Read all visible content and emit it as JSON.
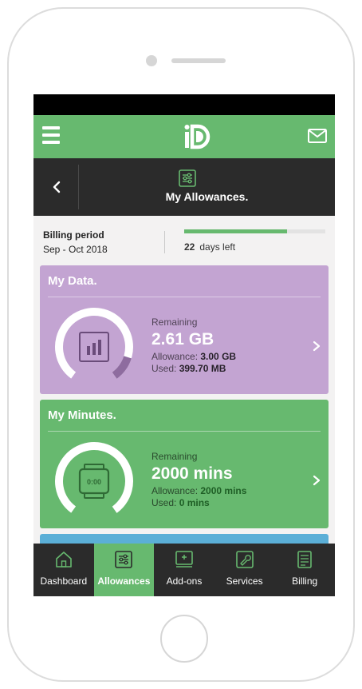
{
  "header": {
    "title": "My Allowances."
  },
  "billing": {
    "label": "Billing period",
    "dates": "Sep - Oct 2018",
    "days_left_value": "22",
    "days_left_text": "days left",
    "progress_fraction": 0.73
  },
  "cards": {
    "data": {
      "title": "My Data.",
      "remaining_label": "Remaining",
      "remaining_value": "2.61 GB",
      "allowance_label": "Allowance:",
      "allowance_value": "3.00 GB",
      "used_label": "Used:",
      "used_value": "399.70 MB",
      "used_fraction": 0.13,
      "color": "#c3a4d2"
    },
    "minutes": {
      "title": "My Minutes.",
      "remaining_label": "Remaining",
      "remaining_value": "2000 mins",
      "allowance_label": "Allowance:",
      "allowance_value": "2000 mins",
      "used_label": "Used:",
      "used_value": "0 mins",
      "timer_text": "0:00",
      "used_fraction": 0,
      "color": "#67b96f"
    }
  },
  "tabs": [
    {
      "label": "Dashboard",
      "icon": "home-icon"
    },
    {
      "label": "Allowances",
      "icon": "sliders-icon",
      "active": true
    },
    {
      "label": "Add-ons",
      "icon": "addon-icon"
    },
    {
      "label": "Services",
      "icon": "wrench-icon"
    },
    {
      "label": "Billing",
      "icon": "bill-icon"
    }
  ],
  "colors": {
    "brand_green": "#67b96f",
    "dark_bar": "#2b2b2b",
    "data_purple": "#c3a4d2",
    "peek_blue": "#5bafd7"
  }
}
